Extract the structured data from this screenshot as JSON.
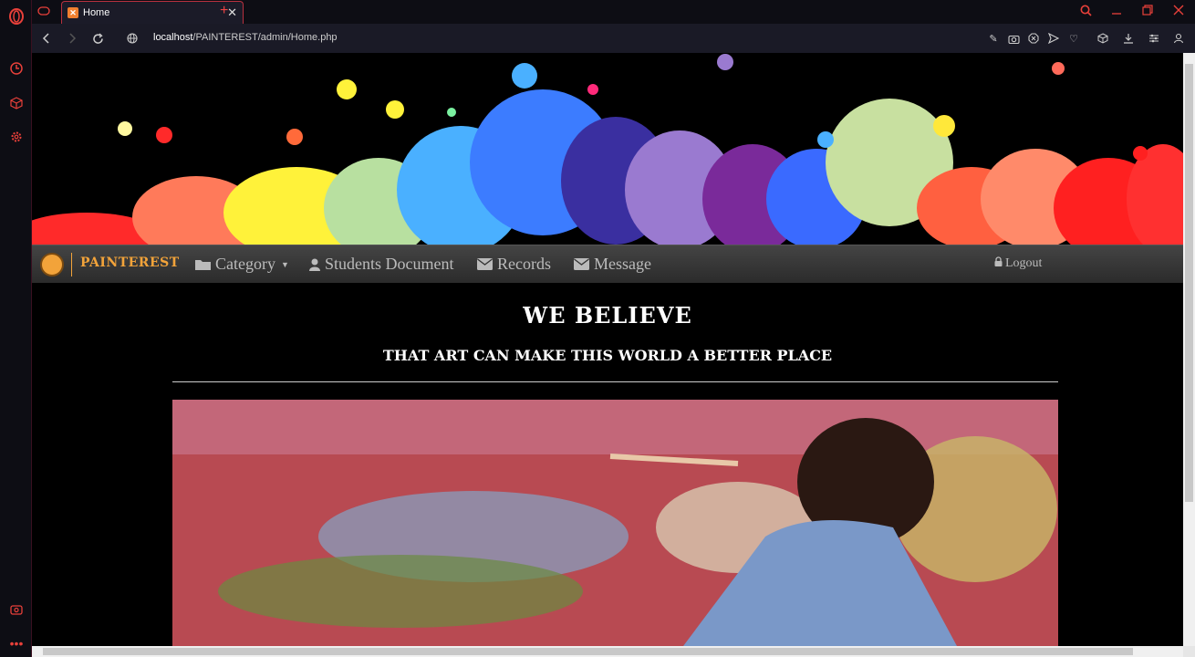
{
  "browser": {
    "tab_title": "Home",
    "url_host": "localhost",
    "url_path": "/PAINTEREST/admin/Home.php",
    "accent": "#e8403a"
  },
  "navbar": {
    "brand": "PAINTEREST",
    "items": [
      {
        "label": "Category",
        "icon": "folder-icon"
      },
      {
        "label": "Students Document",
        "icon": "user-icon"
      },
      {
        "label": "Records",
        "icon": "envelope-icon"
      },
      {
        "label": "Message",
        "icon": "envelope-icon"
      }
    ],
    "logout": "Logout"
  },
  "content": {
    "headline": "WE BELIEVE",
    "subheadline": "THAT ART CAN MAKE THIS WORLD A BETTER PLACE"
  }
}
